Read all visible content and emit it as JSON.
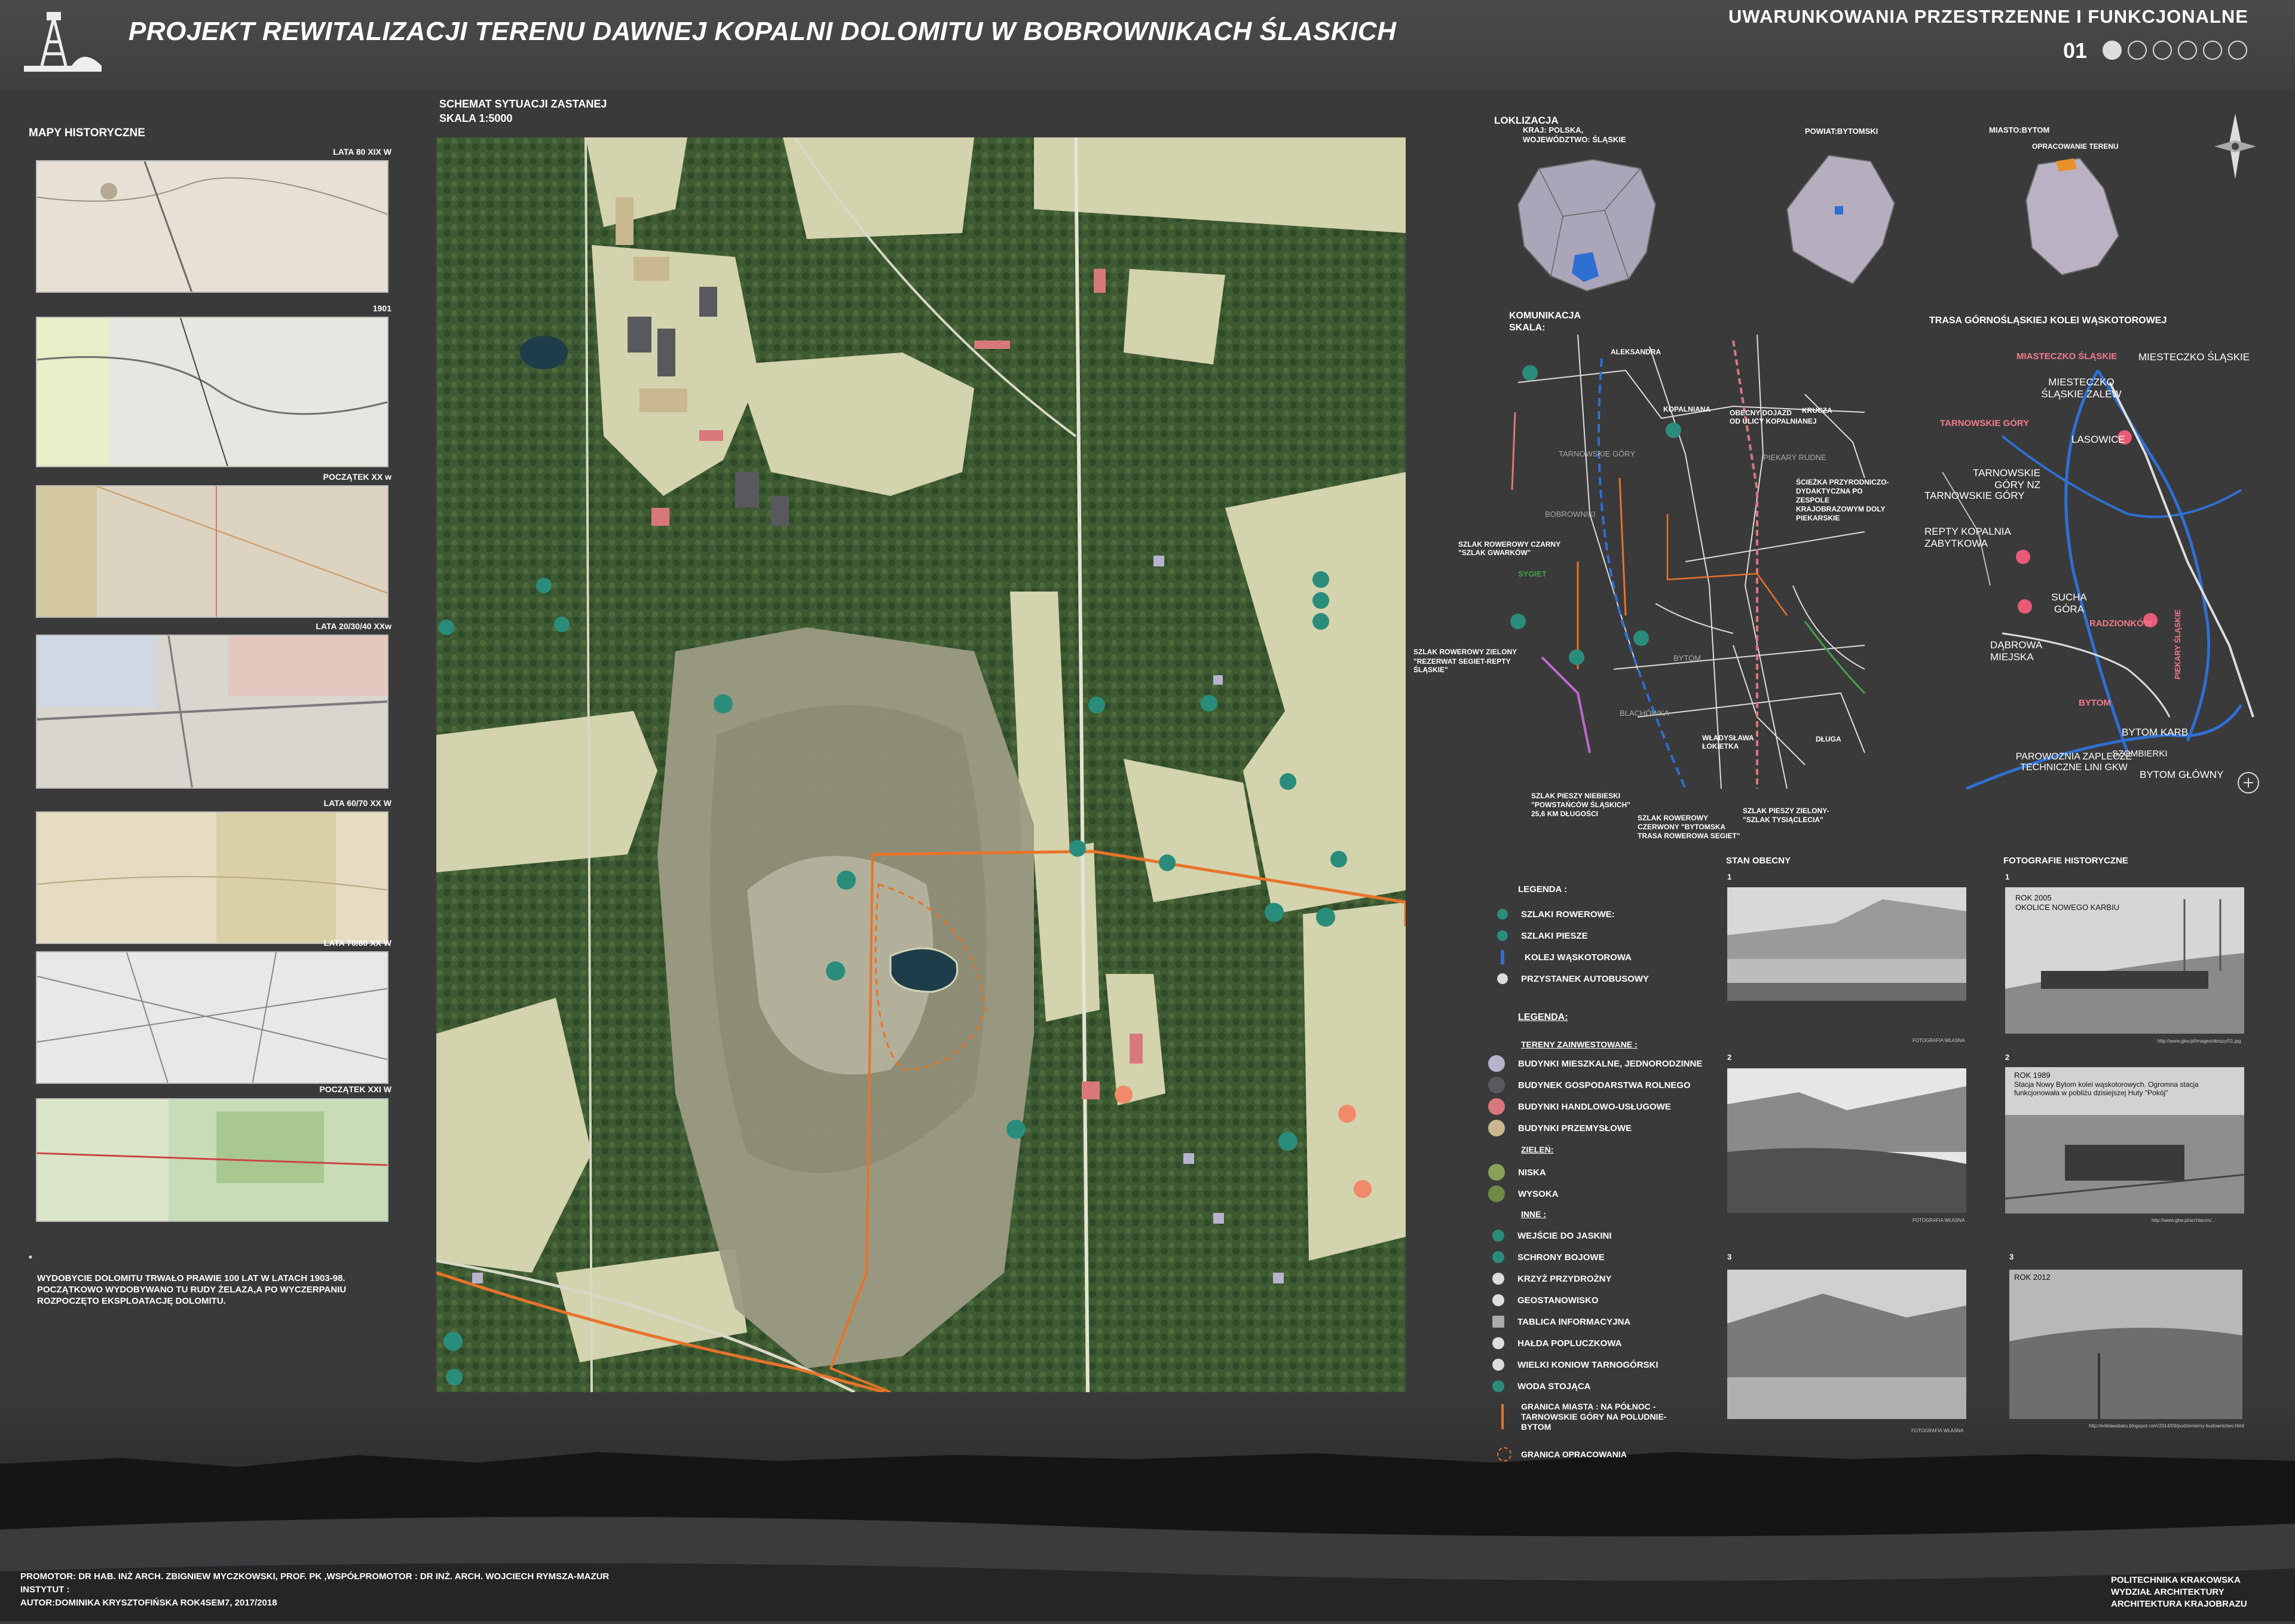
{
  "header": {
    "title": "PROJEKT REWITALIZACJI TERENU DAWNEJ KOPALNI DOLOMITU W BOBROWNIKACH ŚLASKICH",
    "section_title": "UWARUNKOWANIA PRZESTRZENNE I FUNKCJONALNE",
    "page_number": "01",
    "page_dots": 6,
    "active_dot": 1
  },
  "historical_maps": {
    "heading": "MAPY HISTORYCZNE",
    "items": [
      {
        "label": "LATA 80 XIX W",
        "tone": "#e8e0d4"
      },
      {
        "label": "1901",
        "tone": "#e7e6e0"
      },
      {
        "label": "POCZĄTEK XX w",
        "tone": "#dcd3c1"
      },
      {
        "label": "LATA 20/30/40 XXw",
        "tone": "#d9d6cf"
      },
      {
        "label": "LATA 60/70 XX W",
        "tone": "#e6dcc2"
      },
      {
        "label": "LATA 70/80 XX W",
        "tone": "#e8e8e8"
      },
      {
        "label": "POCZĄTEK XXI W",
        "tone": "#c8dcb8"
      }
    ],
    "note_star": "*",
    "note": "WYDOBYCIE DOLOMITU TRWAŁO PRAWIE 100 LAT W LATACH 1903-98. POCZĄTKOWO WYDOBYWANO TU RUDY ŻELAZA,A PO WYCZERPANIU ROZPOCZĘTO EKSPLOATACJĘ DOLOMITU."
  },
  "main_map": {
    "heading": "SCHEMAT SYTUACJI ZASTANEJ",
    "scale": "SKALA  1:5000"
  },
  "location": {
    "heading": "LOKLIZACJA",
    "country": "KRAJ: POLSKA,",
    "voivodeship": "WOJEWÓDZTWO: ŚLĄSKIE",
    "county": "POWIAT:BYTOMSKI",
    "city": "MIASTO:BYTOM",
    "study_area": "OPRACOWANIE TERENU"
  },
  "communication": {
    "heading": "KOMUNIKACJA",
    "scale": "SKALA:",
    "labels": {
      "aleksandra": "ALEKSANDRA",
      "kopalniana": "KOPALNIANA",
      "obecny_dojazd": "OBECNY DOJAZD",
      "od_ulicy": "OD ULICY KOPALNIANEJ",
      "krucza": "KRUCZA",
      "tarnowskie_gory": "TARNOWSKIE GÓRY",
      "piekary_rudne": "PIEKARY RUDNE",
      "bobrowniki": "BOBROWNIKI",
      "sciezka": "ŚCIEŻKA PRZYRODNICZO-DYDAKTYCZNA PO ZESPOLE KRAJOBRAZOWYM DOLY PIEKARSKIE",
      "czarny": "SZLAK ROWEROWY CZARNY",
      "gwarkow": "\"SZLAK GWARKÓW\"",
      "sygiet": "SYGIET",
      "zielony": "SZLAK ROWEROWY ZIELONY",
      "rezerwat": "\"REZERWAT SEGIET-REPTY ŚLĄSKIE\"",
      "bytom": "BYTOM",
      "blachowka": "BLACHÓWKA",
      "wladyslawa": "WŁADYSŁAWA ŁOKIETKA",
      "dluga": "DŁUGA",
      "niebieski": "SZLAK PIESZY NIEBIESKI \"POWSTAŃCÓW ŚLĄSKICH\" 25,6 KM DŁUGOŚCI",
      "czerwony": "SZLAK ROWEROWY CZERWONY \"BYTOMSKA TRASA ROWEROWA SEGIET\"",
      "pieszy_zielony": "SZLAK PIESZY ZIELONY- \"SZLAK TYSIĄCLECIA\""
    }
  },
  "railway": {
    "heading": "TRASA GÓRNOŚLĄSKIEJ KOLEI WĄSKOTOROWEJ",
    "stations": [
      "MIASTECZKO ŚLĄSKIE",
      "MIESTECZKO ŚLĄSKIE",
      "MIESTECZKO ŚLĄSKIE ZALEW",
      "TARNOWSKIE GÓRY",
      "LASOWICE",
      "TARNOWSKIE GÓRY NZ",
      "TARNOWSKIE GÓRY",
      "REPTY KOPALNIA ZABYTKOWA",
      "SUCHA GÓRA",
      "RADZIONKÓW",
      "PIEKARY ŚLĄSKIE",
      "DĄBROWA MIEJSKA",
      "BYTOM",
      "BYTOM KARB",
      "PAROWOZNIA ZAPLECZE TECHNICZNE LINI GKW",
      "SZOMBIERKI",
      "BYTOM GŁÓWNY"
    ]
  },
  "legend1": {
    "heading": "LEGENDA :",
    "items": [
      "SZLAKI ROWEROWE:",
      "SZLAKI PIESZE",
      "KOLEJ WĄSKOTOROWA",
      "PRZYSTANEK AUTOBUSOWY"
    ]
  },
  "legend2": {
    "heading": "LEGENDA:",
    "invested_heading": "TERENY ZAINWESTOWANE :",
    "invested": [
      {
        "label": "BUDYNKI MIESZKALNE, JEDNORODZINNE",
        "color": "#b7b3cc"
      },
      {
        "label": "BUDYNEK GOSPODARSTWA ROLNEGO",
        "color": "#58595c"
      },
      {
        "label": "BUDYNKI HANDLOWO-USŁUGOWE",
        "color": "#d9787c"
      },
      {
        "label": "BUDYNKI PRZEMYSŁOWE",
        "color": "#c9b88f"
      }
    ],
    "green_heading": "ZIELEŃ:",
    "green": [
      {
        "label": "NISKA",
        "color": "#8aa05a"
      },
      {
        "label": "WYSOKA",
        "color": "#6f8a45"
      }
    ],
    "other_heading": "INNE :",
    "other": [
      "WEJŚCIE DO JASKINI",
      "SCHRONY BOJOWE",
      "KRZYŻ PRZYDROŻNY",
      "GEOSTANOWISKO",
      "TABLICA INFORMACYJNA",
      "HAŁDA POPLUCZKOWA",
      "WIELKI KONIOW TARNOGÓRSKI",
      "WODA STOJĄCA"
    ],
    "border_label": "GRANICA MIASTA : NA PÓŁNOC -TARNOWSKIE GÓRY NA POLUDNIE- BYTOM",
    "study_border": "GRANICA OPRACOWANIA"
  },
  "current_state": {
    "heading": "STAN OBECNY",
    "photos": [
      {
        "num": "1",
        "caption": "FOTOGRAFIA WŁASNA"
      },
      {
        "num": "2",
        "caption": "FOTOGRAFIA WŁASNA"
      },
      {
        "num": "3",
        "caption": "FOTOGRAFIA WŁASNA"
      }
    ]
  },
  "historic_photos": {
    "heading": "FOTOGRAFIE HISTORYCZNE",
    "photos": [
      {
        "num": "1",
        "text1": "ROK 2005",
        "text2": "OKOLICE NOWEGO KARBIU",
        "source": "http://www.gkw.pl/images/obrazy/01.jpg"
      },
      {
        "num": "2",
        "text1": "ROK 1989",
        "text2": "Stacja Nowy Bytom kolei wąskotorowych. Ogromna stacja funkcjonowała w pobliżu dzisiejszej Huty \"Pokój\"",
        "source": "http://www.gkw.pl/archiwum/..."
      },
      {
        "num": "3",
        "text1": "ROK 2012",
        "text2": "",
        "source": "http://enklawabaru.blogspot.com/2014/09/podzieniemy-budownictwo.html"
      }
    ]
  },
  "footer": {
    "promotor": "PROMOTOR: DR HAB. INŻ ARCH. ZBIGNIEW MYCZKOWSKI, PROF. PK ,WSPÓŁPROMOTOR : DR INŻ. ARCH. WOJCIECH RYMSZA-MAZUR",
    "institute": "INSTYTUT :",
    "author": "AUTOR:DOMINIKA KRYSZTOFIŃSKA ROK4SEM7, 2017/2018",
    "uni1": "POLITECHNIKA KRAKOWSKA",
    "uni2": "WYDZIAŁ ARCHITEKTURY",
    "uni3": "ARCHITEKTURA KRAJOBRAZU"
  },
  "colors": {
    "background": "#3a3a3b",
    "map_meadow": "#d3d3ae",
    "map_forest": "#3e5a32",
    "quarry": "#9c9c84",
    "city_border": "#e8732a",
    "trail_blue": "#2f6fd1",
    "icon_teal": "#2a8c7a"
  }
}
